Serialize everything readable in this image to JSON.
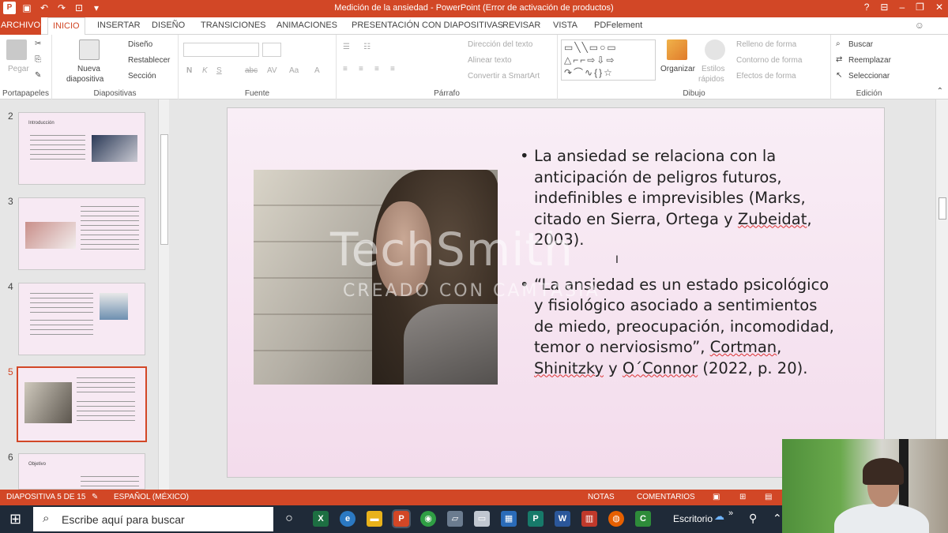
{
  "window": {
    "title": "Medición de la ansiedad -  PowerPoint (Error de activación de productos)",
    "help": "?"
  },
  "menu": {
    "tabs": [
      "ARCHIVO",
      "INICIO",
      "INSERTAR",
      "DISEÑO",
      "TRANSICIONES",
      "ANIMACIONES",
      "PRESENTACIÓN CON DIAPOSITIVAS",
      "REVISAR",
      "VISTA",
      "PDFelement"
    ]
  },
  "ribbon": {
    "portapapeles": {
      "label": "Portapapeles",
      "pegar": "Pegar"
    },
    "diapositivas": {
      "label": "Diapositivas",
      "nueva": "Nueva",
      "nueva2": "diapositiva",
      "diseno": "Diseño",
      "restablecer": "Restablecer",
      "seccion": "Sección"
    },
    "fuente": {
      "label": "Fuente",
      "bold": "N",
      "italic": "K",
      "underline": "S",
      "strike": "abc",
      "spacing": "AV",
      "case": "Aa",
      "color": "A"
    },
    "parrafo": {
      "label": "Párrafo",
      "direccion": "Dirección del texto",
      "alinear": "Alinear texto",
      "convertir": "Convertir a SmartArt"
    },
    "dibujo": {
      "label": "Dibujo",
      "organizar": "Organizar",
      "estilos": "Estilos",
      "rapidos": "rápidos",
      "relleno": "Relleno de forma",
      "contorno": "Contorno de forma",
      "efectos": "Efectos de forma"
    },
    "edicion": {
      "label": "Edición",
      "buscar": "Buscar",
      "reemplazar": "Reemplazar",
      "seleccionar": "Seleccionar"
    }
  },
  "thumbnails": {
    "n2": "2",
    "n3": "3",
    "n4": "4",
    "n5": "5",
    "n6": "6",
    "t2_title": "Introducción",
    "t6_title": "Objetivo"
  },
  "slide": {
    "bullet1_a": "La ansiedad se relaciona con la anticipación de peligros futuros, indefinibles e imprevisibles (Marks, citado en Sierra, Ortega y ",
    "bullet1_err": "Zubeidat",
    "bullet1_b": ", 2003).",
    "bullet2_a": "“La ansiedad es un estado psicológico y fisiológico asociado a sentimientos de miedo, preocupación, incomodidad, temor o nerviosismo”, ",
    "bullet2_err1": "Cortman",
    "bullet2_c": ", ",
    "bullet2_err2": "Shinitzky",
    "bullet2_d": " y ",
    "bullet2_err3": "O´Connor",
    "bullet2_e": " (2022, p. 20)."
  },
  "watermark": {
    "line1": "TechSmith",
    "line2": "CREADO CON CAMTASIA"
  },
  "status": {
    "slide_count": "DIAPOSITIVA 5 DE 15",
    "language": "ESPAÑOL (MÉXICO)",
    "notes": "NOTAS",
    "comments": "COMENTARIOS"
  },
  "taskbar": {
    "search_placeholder": "Escribe aquí para buscar",
    "desktop_label": "Escritorio"
  },
  "colors": {
    "accent": "#d24726",
    "taskbar": "#1f2a38"
  }
}
